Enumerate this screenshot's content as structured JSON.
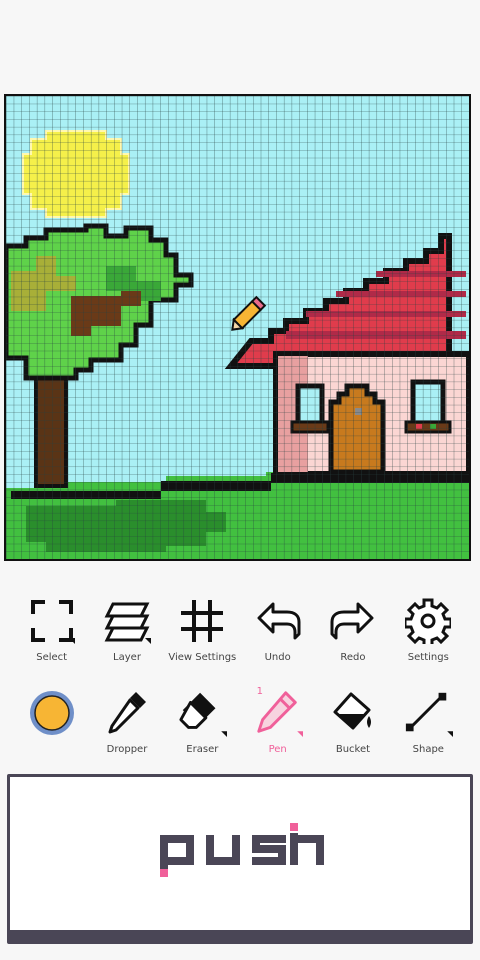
{
  "toolbar_top": [
    {
      "id": "select",
      "label": "Select",
      "icon": "select-icon"
    },
    {
      "id": "layer",
      "label": "Layer",
      "icon": "layers-icon"
    },
    {
      "id": "view",
      "label": "View Settings",
      "icon": "grid-icon"
    },
    {
      "id": "undo",
      "label": "Undo",
      "icon": "undo-arrow-icon"
    },
    {
      "id": "redo",
      "label": "Redo",
      "icon": "redo-arrow-icon"
    },
    {
      "id": "settings",
      "label": "Settings",
      "icon": "gear-icon"
    }
  ],
  "toolbar_bottom": [
    {
      "id": "color",
      "label": "",
      "icon": "color-swatch-icon"
    },
    {
      "id": "dropper",
      "label": "Dropper",
      "icon": "dropper-icon"
    },
    {
      "id": "eraser",
      "label": "Eraser",
      "icon": "eraser-icon"
    },
    {
      "id": "pen",
      "label": "Pen",
      "icon": "pen-icon",
      "count": "1"
    },
    {
      "id": "bucket",
      "label": "Bucket",
      "icon": "bucket-icon"
    },
    {
      "id": "shape",
      "label": "Shape",
      "icon": "shape-line-icon"
    }
  ],
  "current_color": "#f7b534",
  "push_text": "push",
  "colors": {
    "sky": "#aaf0f5",
    "grid": "#2a4a4a",
    "sun": "#f5f04a",
    "grass": "#42c040",
    "roof": "#e03c4c",
    "wall": "#fbd6d3",
    "door": "#c87a1e",
    "accent": "#f0609a"
  }
}
